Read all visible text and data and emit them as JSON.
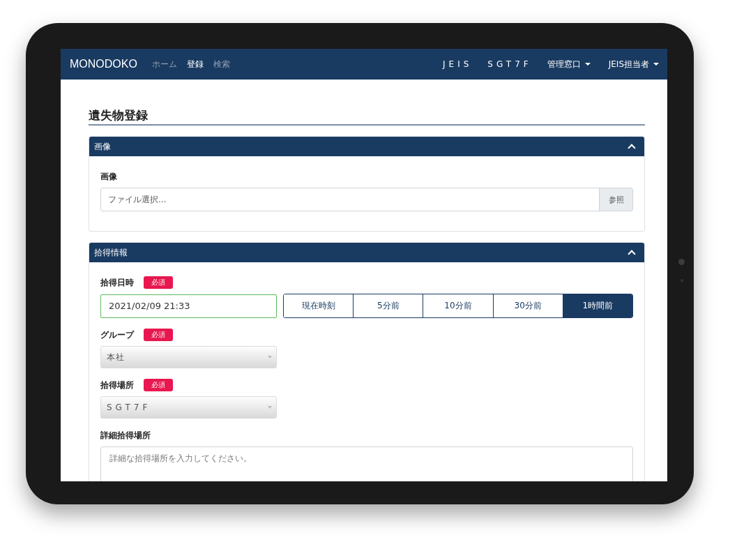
{
  "navbar": {
    "brand": "MONODOKO",
    "links": [
      {
        "label": "ホーム",
        "selected": false
      },
      {
        "label": "登録",
        "selected": true
      },
      {
        "label": "検索",
        "selected": false
      }
    ],
    "right_items": [
      {
        "label": "JEIS",
        "dropdown": false
      },
      {
        "label": "SGT7F",
        "dropdown": false
      },
      {
        "label": "管理窓口",
        "dropdown": true
      },
      {
        "label": "JEIS担当者",
        "dropdown": true
      }
    ]
  },
  "page_title": "遺失物登録",
  "panels": [
    {
      "title": "画像",
      "expanded": true,
      "fields": [
        {
          "kind": "file",
          "label": "画像",
          "placeholder": "ファイル選択...",
          "button": "参照"
        }
      ]
    },
    {
      "title": "拾得情報",
      "expanded": true,
      "fields": [
        {
          "kind": "datetime",
          "label": "拾得日時",
          "badge": "必須",
          "value": "2021/02/09 21:33",
          "quick_buttons": [
            {
              "label": "現在時刻",
              "selected": false
            },
            {
              "label": "5分前",
              "selected": false
            },
            {
              "label": "10分前",
              "selected": false
            },
            {
              "label": "30分前",
              "selected": false
            },
            {
              "label": "1時間前",
              "selected": true
            }
          ]
        },
        {
          "kind": "select",
          "label": "グループ",
          "badge": "必須",
          "value": "本社"
        },
        {
          "kind": "select",
          "label": "拾得場所",
          "badge": "必須",
          "value": "SGT7F"
        },
        {
          "kind": "textarea",
          "label": "詳細拾得場所",
          "placeholder": "詳細な拾得場所を入力してください。"
        }
      ]
    }
  ]
}
